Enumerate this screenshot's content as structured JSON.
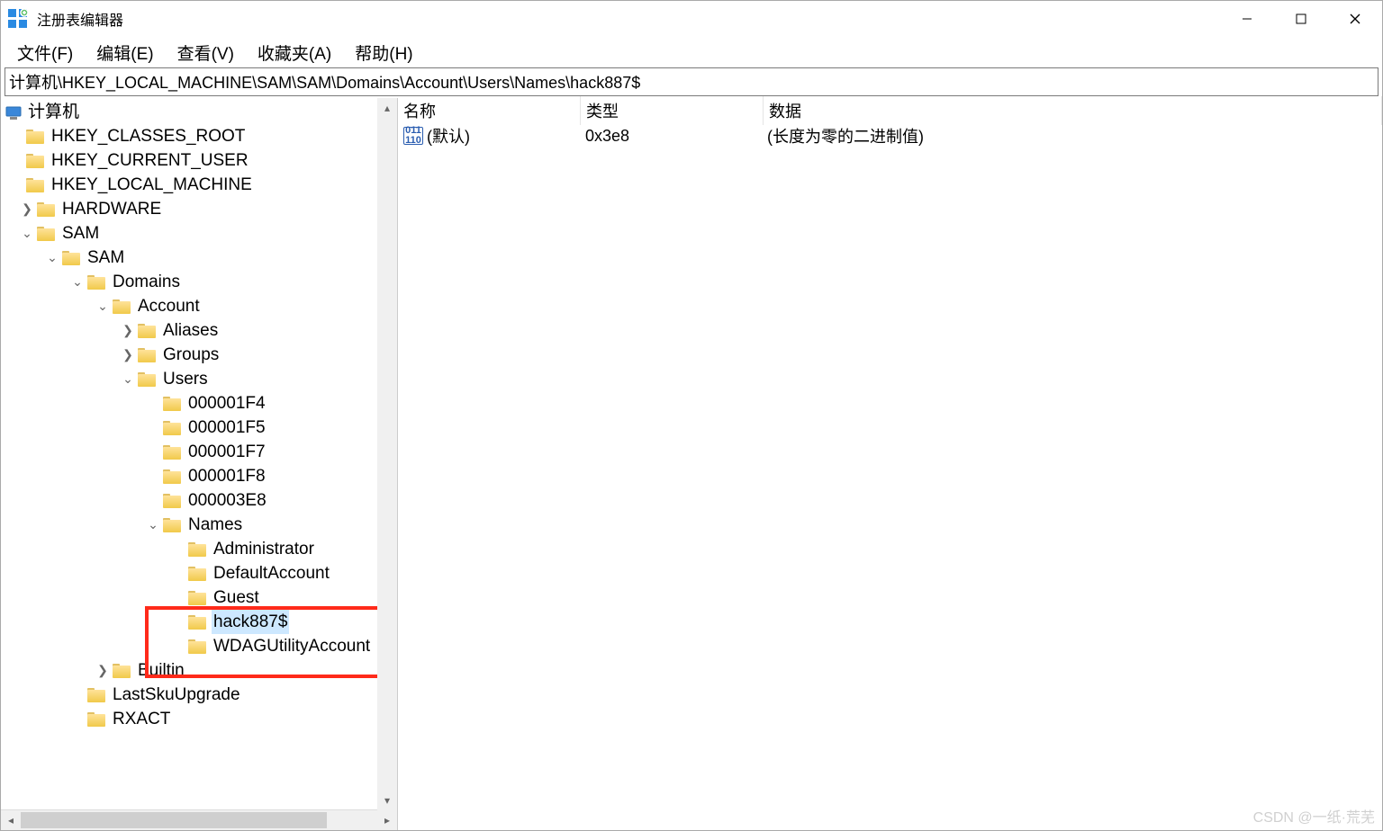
{
  "window": {
    "title": "注册表编辑器"
  },
  "menu": {
    "file": "文件(F)",
    "edit": "编辑(E)",
    "view": "查看(V)",
    "favorites": "收藏夹(A)",
    "help": "帮助(H)"
  },
  "addressbar": {
    "path": "计算机\\HKEY_LOCAL_MACHINE\\SAM\\SAM\\Domains\\Account\\Users\\Names\\hack887$"
  },
  "tree": {
    "root": "计算机",
    "hkcr": "HKEY_CLASSES_ROOT",
    "hkcu": "HKEY_CURRENT_USER",
    "hklm": "HKEY_LOCAL_MACHINE",
    "hardware": "HARDWARE",
    "sam1": "SAM",
    "sam2": "SAM",
    "domains": "Domains",
    "account": "Account",
    "aliases": "Aliases",
    "groups": "Groups",
    "users": "Users",
    "u1": "000001F4",
    "u2": "000001F5",
    "u3": "000001F7",
    "u4": "000001F8",
    "u5": "000003E8",
    "names": "Names",
    "n1": "Administrator",
    "n2": "DefaultAccount",
    "n3": "Guest",
    "n4": "hack887$",
    "n5": "WDAGUtilityAccount",
    "builtin": "Builtin",
    "lastsku": "LastSkuUpgrade",
    "rxact": "RXACT"
  },
  "list": {
    "headers": {
      "name": "名称",
      "type": "类型",
      "data": "数据"
    },
    "row": {
      "name": "(默认)",
      "type": "0x3e8",
      "data": "(长度为零的二进制值)"
    }
  },
  "watermark": "CSDN @一纸·荒芜"
}
